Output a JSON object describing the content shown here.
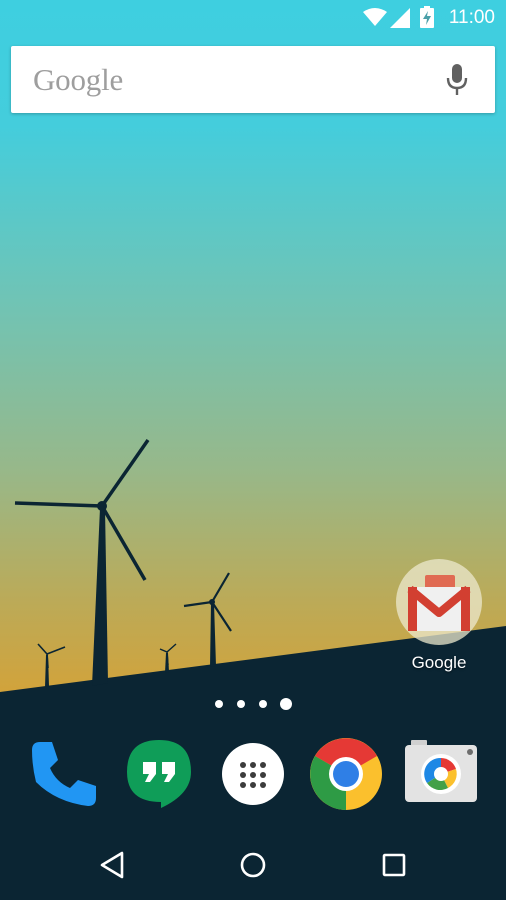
{
  "status_bar": {
    "time": "11:00",
    "icons": [
      "wifi-icon",
      "cell-signal-icon",
      "battery-charging-icon"
    ]
  },
  "search": {
    "logo_text": "Google",
    "voice_icon": "mic-icon"
  },
  "home": {
    "folder": {
      "label": "Google",
      "icon": "gmail-icon"
    },
    "page_indicator": {
      "pages": 4,
      "current": 4
    }
  },
  "dock": {
    "apps": [
      "phone-icon",
      "hangouts-icon",
      "app-drawer-icon",
      "chrome-icon",
      "camera-icon"
    ]
  },
  "nav": {
    "buttons": [
      "back-icon",
      "home-icon",
      "recents-icon"
    ]
  },
  "colors": {
    "sky_top": "#3ecfe0",
    "horizon": "#d9a030",
    "ground": "#0b2533",
    "hangouts_green": "#0f9d58",
    "phone_blue": "#2196f3",
    "gmail_red": "#d23f31"
  }
}
